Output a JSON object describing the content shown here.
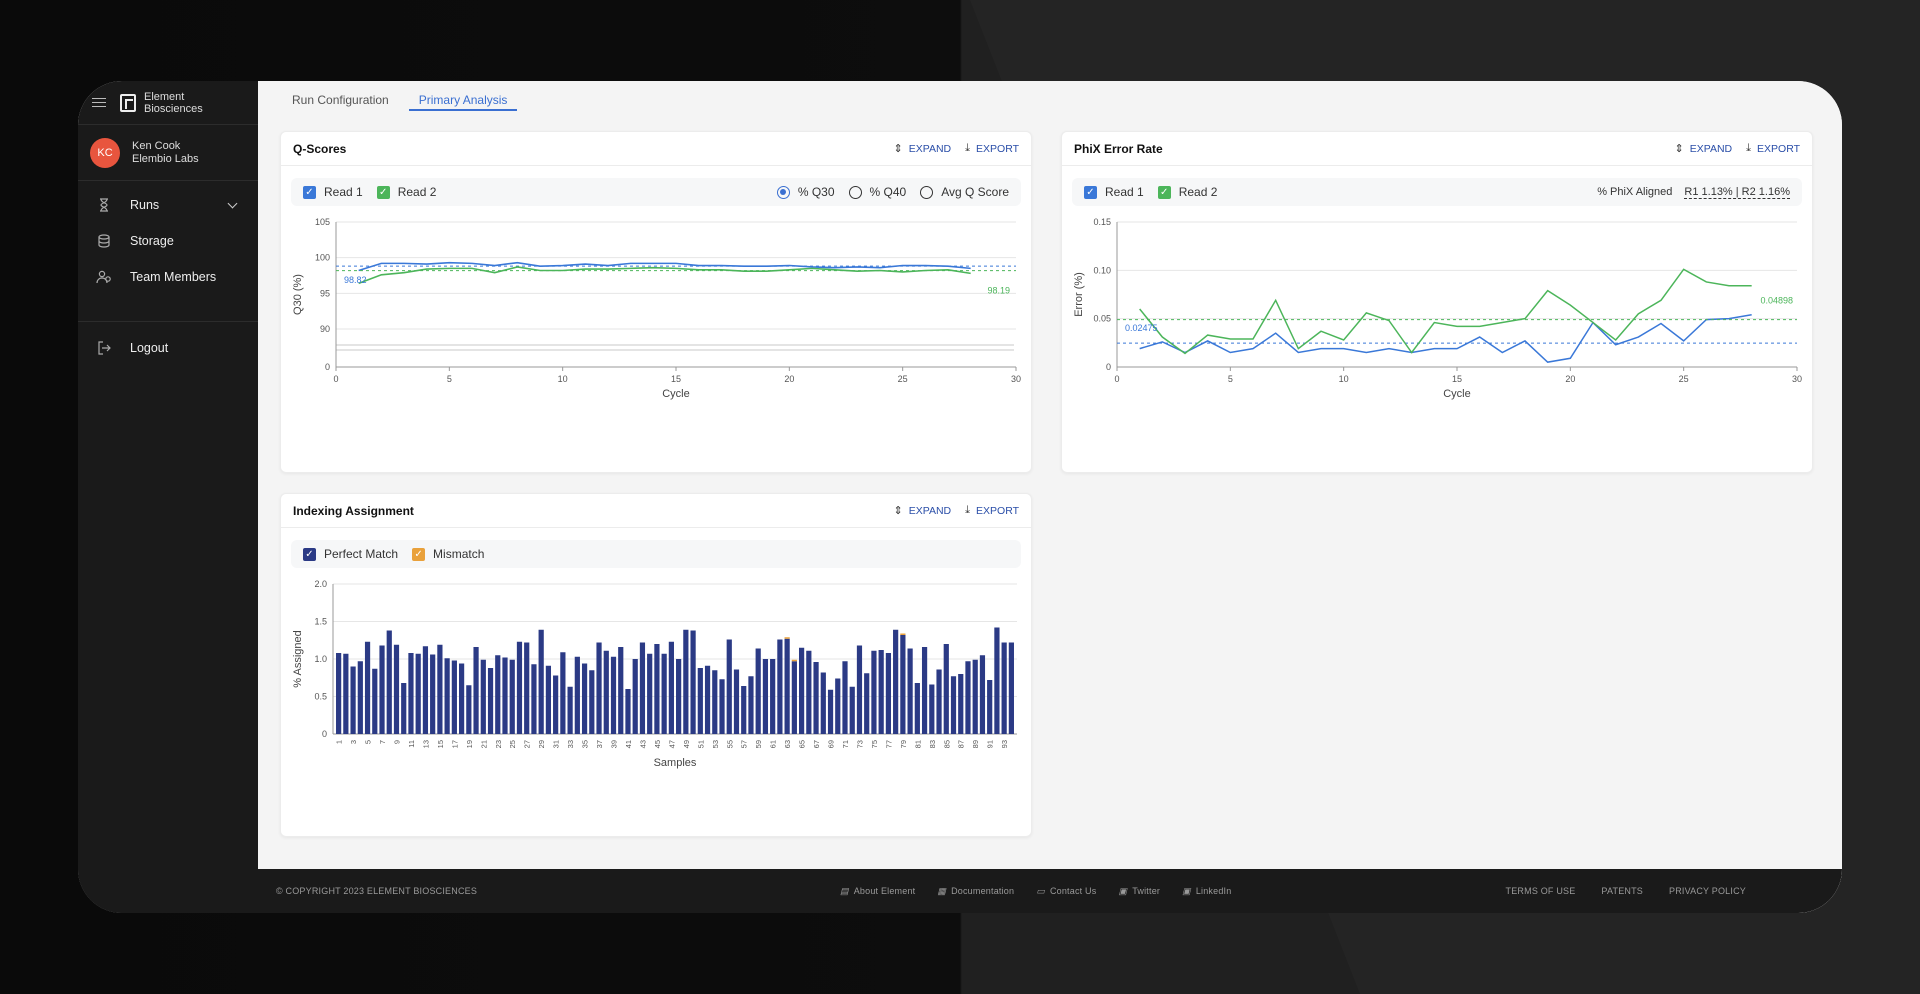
{
  "brand": {
    "line1": "Element",
    "line2": "Biosciences"
  },
  "user": {
    "initials": "KC",
    "name": "Ken Cook",
    "org": "Elembio Labs"
  },
  "nav": {
    "runs": "Runs",
    "storage": "Storage",
    "team": "Team Members",
    "logout": "Logout"
  },
  "tabs": {
    "config": "Run Configuration",
    "primary": "Primary Analysis"
  },
  "actions": {
    "expand": "EXPAND",
    "export": "EXPORT"
  },
  "qscores": {
    "title": "Q-Scores",
    "read1": "Read 1",
    "read2": "Read 2",
    "opt_q30": "% Q30",
    "opt_q40": "% Q40",
    "opt_avg": "Avg Q Score"
  },
  "phix": {
    "title": "PhiX Error Rate",
    "read1": "Read 1",
    "read2": "Read 2",
    "aligned_label": "% PhiX Aligned",
    "aligned_value": "R1 1.13% | R2 1.16%"
  },
  "indexing": {
    "title": "Indexing Assignment",
    "perfect": "Perfect Match",
    "mismatch": "Mismatch"
  },
  "colors": {
    "read1": "#3a78d8",
    "read2": "#4cb55a",
    "perfect": "#2b3a85",
    "mismatch": "#e9a13b",
    "avatar": "#e8553e",
    "accent": "#3a6fd1"
  },
  "chart_data": [
    {
      "type": "line",
      "title": "Q-Scores",
      "xlabel": "Cycle",
      "ylabel": "Q30 (%)",
      "xlim": [
        0,
        30
      ],
      "y_ticks": [
        0,
        90,
        95,
        100,
        105
      ],
      "x_ticks": [
        0,
        5,
        10,
        15,
        20,
        25,
        30
      ],
      "axis_break": true,
      "grid": true,
      "x": [
        1,
        2,
        3,
        4,
        5,
        6,
        7,
        8,
        9,
        10,
        11,
        12,
        13,
        14,
        15,
        16,
        17,
        18,
        19,
        20,
        21,
        22,
        23,
        24,
        25,
        26,
        27,
        28
      ],
      "series": [
        {
          "name": "Read 1",
          "values": [
            98.2,
            99.2,
            99.2,
            99.1,
            99.3,
            99.2,
            98.9,
            99.3,
            98.8,
            98.9,
            99.1,
            98.9,
            99.2,
            99.2,
            99.2,
            98.9,
            98.9,
            98.8,
            98.8,
            98.9,
            98.7,
            98.6,
            98.7,
            98.6,
            98.9,
            98.9,
            98.8,
            98.5
          ],
          "mean": 98.82,
          "mean_label": "98.82"
        },
        {
          "name": "Read 2",
          "values": [
            96.4,
            97.6,
            97.9,
            98.4,
            98.5,
            98.5,
            97.9,
            98.7,
            98.2,
            98.2,
            98.4,
            98.4,
            98.5,
            98.6,
            98.5,
            98.3,
            98.3,
            98.1,
            98.1,
            98.3,
            98.5,
            98.3,
            98.1,
            98.2,
            98.0,
            98.2,
            98.3,
            97.8
          ],
          "mean": 98.19,
          "mean_label": "98.19"
        }
      ]
    },
    {
      "type": "line",
      "title": "PhiX Error Rate",
      "xlabel": "Cycle",
      "ylabel": "Error (%)",
      "xlim": [
        0,
        30
      ],
      "ylim": [
        0,
        0.15
      ],
      "y_ticks": [
        0,
        0.05,
        0.1,
        0.15
      ],
      "y_tick_labels": [
        "0",
        "0.05",
        "0.10",
        "0.15"
      ],
      "x_ticks": [
        0,
        5,
        10,
        15,
        20,
        25,
        30
      ],
      "grid": true,
      "x": [
        1,
        2,
        3,
        4,
        5,
        6,
        7,
        8,
        9,
        10,
        11,
        12,
        13,
        14,
        15,
        16,
        17,
        18,
        19,
        20,
        21,
        22,
        23,
        24,
        25,
        26,
        27,
        28
      ],
      "series": [
        {
          "name": "Read 1",
          "values": [
            0.019,
            0.026,
            0.015,
            0.027,
            0.015,
            0.019,
            0.035,
            0.015,
            0.019,
            0.019,
            0.015,
            0.019,
            0.015,
            0.019,
            0.019,
            0.031,
            0.015,
            0.027,
            0.005,
            0.009,
            0.046,
            0.023,
            0.031,
            0.045,
            0.027,
            0.049,
            0.05,
            0.054
          ],
          "mean": 0.02475,
          "mean_label": "0.02475"
        },
        {
          "name": "Read 2",
          "values": [
            0.06,
            0.031,
            0.014,
            0.033,
            0.029,
            0.029,
            0.069,
            0.019,
            0.037,
            0.028,
            0.056,
            0.048,
            0.015,
            0.046,
            0.042,
            0.042,
            0.046,
            0.05,
            0.079,
            0.064,
            0.046,
            0.028,
            0.055,
            0.069,
            0.101,
            0.088,
            0.084,
            0.084
          ],
          "mean": 0.04898,
          "mean_label": "0.04898"
        }
      ]
    },
    {
      "type": "bar",
      "title": "Indexing Assignment",
      "xlabel": "Samples",
      "ylabel": "% Assigned",
      "ylim": [
        0,
        2.0
      ],
      "y_ticks": [
        0,
        0.5,
        1.0,
        1.5,
        2.0
      ],
      "y_tick_labels": [
        "0",
        "0.5",
        "1.0",
        "1.5",
        "2.0"
      ],
      "grid": true,
      "categories": [
        "1",
        "2",
        "3",
        "4",
        "5",
        "6",
        "7",
        "8",
        "9",
        "10",
        "11",
        "12",
        "13",
        "14",
        "15",
        "16",
        "17",
        "18",
        "19",
        "20",
        "21",
        "22",
        "23",
        "24",
        "25",
        "26",
        "27",
        "28",
        "29",
        "30",
        "31",
        "32",
        "33",
        "34",
        "35",
        "36",
        "37",
        "38",
        "39",
        "40",
        "41",
        "42",
        "43",
        "44",
        "45",
        "46",
        "47",
        "48",
        "49",
        "50",
        "51",
        "52",
        "53",
        "54",
        "55",
        "56",
        "57",
        "58",
        "59",
        "60",
        "61",
        "62",
        "63",
        "64",
        "65",
        "66",
        "67",
        "68",
        "69",
        "70",
        "71",
        "72",
        "73",
        "74",
        "75",
        "76",
        "77",
        "78",
        "79",
        "80",
        "81",
        "82",
        "83",
        "84",
        "85",
        "86",
        "87",
        "88",
        "89",
        "90",
        "91",
        "92",
        "93",
        "94"
      ],
      "shown_tick_labels": [
        "1",
        "3",
        "5",
        "7",
        "9",
        "11",
        "13",
        "15",
        "17",
        "19",
        "21",
        "23",
        "25",
        "27",
        "29",
        "31",
        "33",
        "35",
        "37",
        "39",
        "41",
        "43",
        "45",
        "47",
        "49",
        "51",
        "53",
        "55",
        "57",
        "59",
        "61",
        "63",
        "65",
        "67",
        "69",
        "71",
        "73",
        "75",
        "77",
        "79",
        "81",
        "83",
        "85",
        "87",
        "89",
        "91",
        "93"
      ],
      "series": [
        {
          "name": "Perfect Match",
          "values": [
            1.08,
            1.07,
            0.9,
            0.97,
            1.23,
            0.87,
            1.18,
            1.38,
            1.19,
            0.68,
            1.08,
            1.07,
            1.17,
            1.06,
            1.19,
            1.01,
            0.98,
            0.94,
            0.65,
            1.16,
            0.99,
            0.88,
            1.05,
            1.02,
            0.99,
            1.23,
            1.22,
            0.93,
            1.39,
            0.91,
            0.78,
            1.09,
            0.63,
            1.03,
            0.94,
            0.85,
            1.22,
            1.11,
            1.03,
            1.16,
            0.6,
            1.0,
            1.22,
            1.07,
            1.2,
            1.07,
            1.23,
            1.0,
            1.39,
            1.38,
            0.88,
            0.91,
            0.85,
            0.73,
            1.26,
            0.86,
            0.64,
            0.77,
            1.14,
            1.0,
            1.0,
            1.26,
            1.27,
            0.97,
            1.15,
            1.11,
            0.96,
            0.82,
            0.59,
            0.74,
            0.97,
            0.63,
            1.18,
            0.81,
            1.11,
            1.12,
            1.08,
            1.39,
            1.32,
            1.14,
            0.68,
            1.16,
            0.66,
            0.86,
            1.2,
            0.77,
            0.8,
            0.97,
            0.99,
            1.05,
            0.72,
            1.42,
            1.22,
            1.22
          ]
        },
        {
          "name": "Mismatch",
          "values": [
            0,
            0,
            0,
            0,
            0,
            0,
            0,
            0,
            0,
            0,
            0,
            0,
            0,
            0,
            0,
            0,
            0,
            0,
            0,
            0,
            0,
            0,
            0,
            0,
            0,
            0,
            0,
            0,
            0,
            0,
            0,
            0,
            0,
            0,
            0,
            0,
            0,
            0,
            0,
            0,
            0,
            0,
            0,
            0,
            0,
            0,
            0,
            0,
            0,
            0,
            0,
            0,
            0,
            0,
            0,
            0,
            0,
            0,
            0,
            0,
            0,
            0,
            0.02,
            0.02,
            0,
            0,
            0,
            0,
            0,
            0,
            0,
            0,
            0,
            0,
            0,
            0,
            0,
            0,
            0.02,
            0,
            0,
            0,
            0,
            0,
            0,
            0,
            0,
            0,
            0,
            0,
            0,
            0,
            0,
            0
          ]
        }
      ]
    }
  ],
  "footer": {
    "copyright": "© COPYRIGHT 2023 ELEMENT BIOSCIENCES",
    "about": "About Element",
    "docs": "Documentation",
    "contact": "Contact Us",
    "twitter": "Twitter",
    "linkedin": "LinkedIn",
    "terms": "TERMS OF USE",
    "patents": "PATENTS",
    "privacy": "PRIVACY POLICY"
  }
}
